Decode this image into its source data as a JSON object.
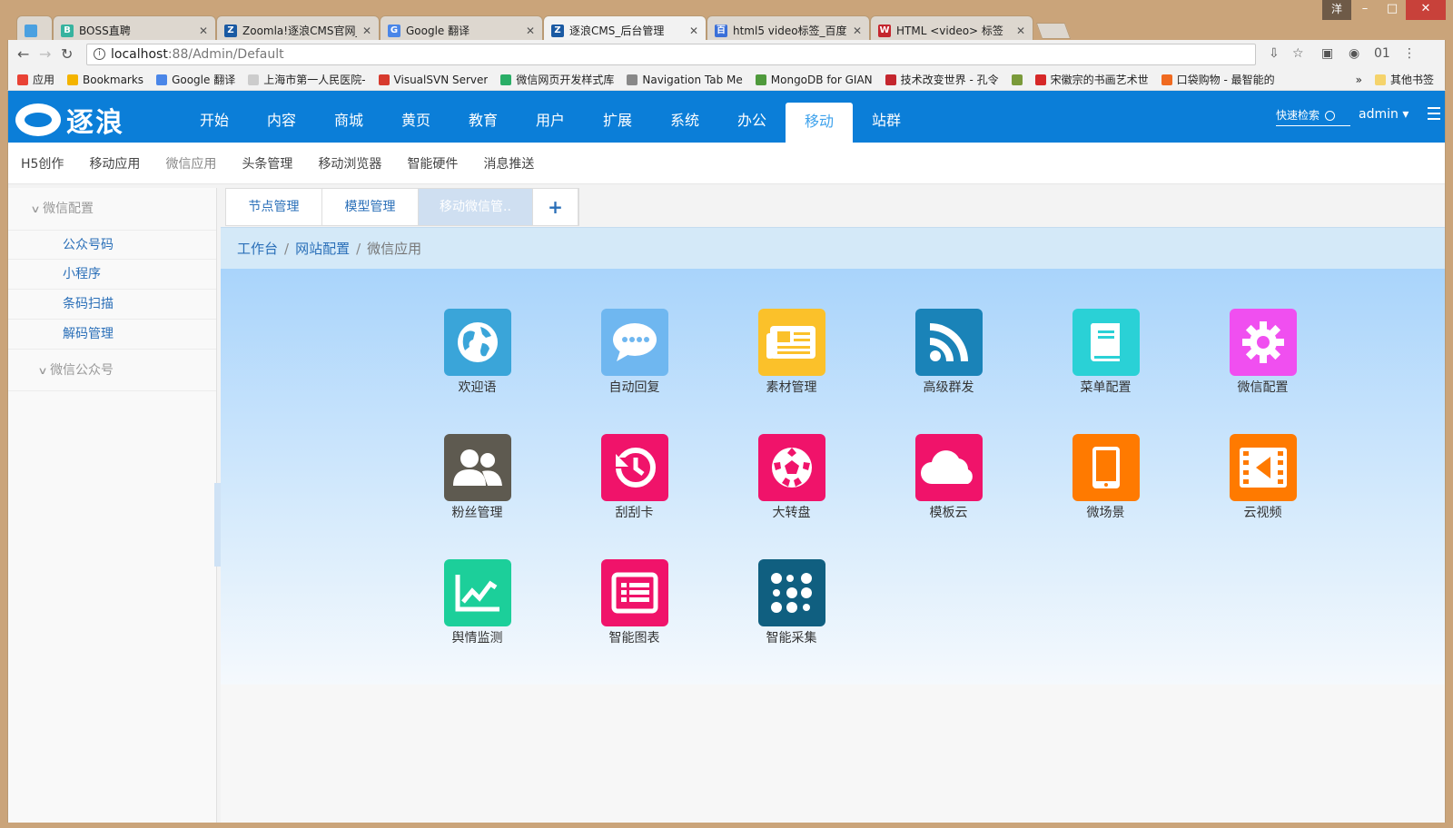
{
  "window": {
    "user_initial": "洋",
    "minimize": "–",
    "maximize": "□",
    "close": "✕"
  },
  "browser_tabs": [
    {
      "title": "",
      "color": "#4aa0e0",
      "fav": ""
    },
    {
      "title": "BOSS直聘",
      "color": "#37b39f",
      "fav": "B"
    },
    {
      "title": "Zoomla!逐浪CMS官网_/",
      "color": "#1a5aa3",
      "fav": "Z"
    },
    {
      "title": "Google 翻译",
      "color": "#4a86e8",
      "fav": "G"
    },
    {
      "title": "逐浪CMS_后台管理",
      "color": "#1a5aa3",
      "fav": "Z",
      "active": true
    },
    {
      "title": "html5 video标签_百度",
      "color": "#3a6fd8",
      "fav": "百"
    },
    {
      "title": "HTML <video> 标签",
      "color": "#c4262e",
      "fav": "W"
    }
  ],
  "tab_close": "✕",
  "address": {
    "host": "localhost",
    "path": ":88/Admin/Default",
    "info": "i"
  },
  "nav": {
    "back": "←",
    "forward": "→",
    "reload": "↻"
  },
  "extensions": [
    "⇩",
    "☆",
    "▣",
    "◉",
    "01",
    "⋮"
  ],
  "bookmarks": [
    {
      "label": "应用",
      "color": "#e94235"
    },
    {
      "label": "Bookmarks",
      "color": "#f4b400"
    },
    {
      "label": "Google 翻译",
      "color": "#4a86e8"
    },
    {
      "label": "上海市第一人民医院-",
      "color": "#cccccc"
    },
    {
      "label": "VisualSVN Server",
      "color": "#d73a2e"
    },
    {
      "label": "微信网页开发样式库",
      "color": "#2aae67"
    },
    {
      "label": "Navigation Tab Me",
      "color": "#888888"
    },
    {
      "label": "MongoDB for GIAN",
      "color": "#4f9a3c"
    },
    {
      "label": "技术改变世界 - 孔令",
      "color": "#c4262e"
    },
    {
      "label": "",
      "color": "#7a9a3a"
    },
    {
      "label": "宋徽宗的书画艺术世",
      "color": "#d62828"
    },
    {
      "label": "口袋购物 - 最智能的",
      "color": "#f06a20"
    }
  ],
  "bookmarks_more": "»",
  "other_bookmarks": "其他书签",
  "brand": {
    "logo_text": "逐浪"
  },
  "top_menu": [
    "开始",
    "内容",
    "商城",
    "黄页",
    "教育",
    "用户",
    "扩展",
    "系统",
    "办公",
    "移动",
    "站群"
  ],
  "top_menu_active": 9,
  "quick_search": "快速检索",
  "admin": "admin ▾",
  "sub_menu": [
    {
      "label": "H5创作"
    },
    {
      "label": "移动应用"
    },
    {
      "label": "微信应用",
      "dim": true
    },
    {
      "label": "头条管理"
    },
    {
      "label": "移动浏览器"
    },
    {
      "label": "智能硬件"
    },
    {
      "label": "消息推送"
    }
  ],
  "sidebar": {
    "group1": "微信配置",
    "items": [
      "公众号码",
      "小程序",
      "条码扫描",
      "解码管理"
    ],
    "group2": "微信公众号",
    "chevron": "∨",
    "collapse": "‹"
  },
  "content_tabs": [
    "节点管理",
    "模型管理",
    "移动微信管..",
    "+"
  ],
  "breadcrumb": {
    "home": "工作台",
    "mid": "网站配置",
    "current": "微信应用",
    "sep": "/"
  },
  "apps": [
    {
      "label": "欢迎语",
      "icon": "globe-icon",
      "color": "#3aa5d9"
    },
    {
      "label": "自动回复",
      "icon": "chat-icon",
      "color": "#6fb7f0"
    },
    {
      "label": "素材管理",
      "icon": "newspaper-icon",
      "color": "#fbc12a"
    },
    {
      "label": "高级群发",
      "icon": "rss-icon",
      "color": "#1a83b8"
    },
    {
      "label": "菜单配置",
      "icon": "book-icon",
      "color": "#2ad1d6"
    },
    {
      "label": "微信配置",
      "icon": "gear-icon",
      "color": "#f04ff0"
    },
    {
      "label": "粉丝管理",
      "icon": "users-icon",
      "color": "#5e5a50"
    },
    {
      "label": "刮刮卡",
      "icon": "history-icon",
      "color": "#f0136a"
    },
    {
      "label": "大转盘",
      "icon": "soccer-icon",
      "color": "#f0136a"
    },
    {
      "label": "模板云",
      "icon": "cloud-icon",
      "color": "#f0136a"
    },
    {
      "label": "微场景",
      "icon": "tablet-icon",
      "color": "#ff7a00"
    },
    {
      "label": "云视频",
      "icon": "film-icon",
      "color": "#ff7a00"
    },
    {
      "label": "舆情监测",
      "icon": "line-chart-icon",
      "color": "#1ccf9a"
    },
    {
      "label": "智能图表",
      "icon": "list-alt-icon",
      "color": "#f0136a"
    },
    {
      "label": "智能采集",
      "icon": "braille-icon",
      "color": "#105f80"
    }
  ],
  "colors": {
    "accent": "#0b7ed8",
    "link": "#2a6fb8"
  }
}
